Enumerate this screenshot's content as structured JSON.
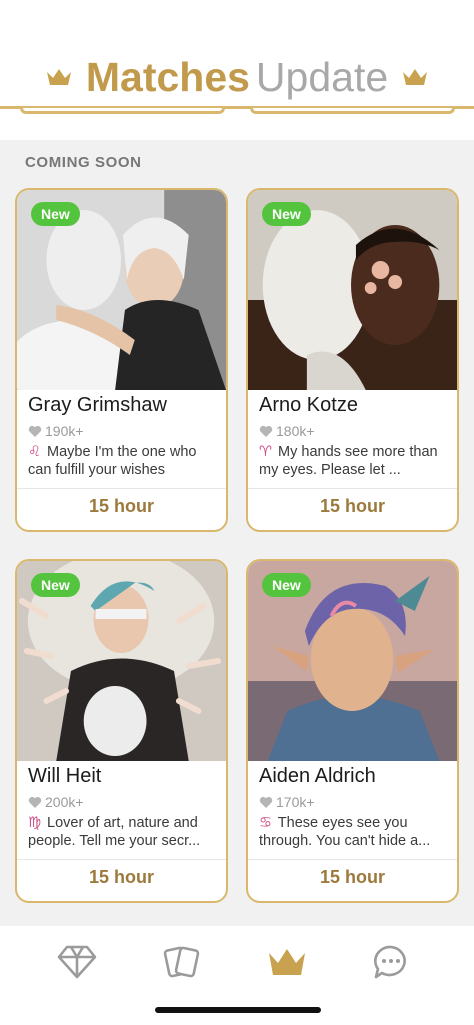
{
  "header": {
    "title_bold": "Matches",
    "title_light": "Update",
    "left_icon": "crown-icon",
    "right_icon": "crown-icon"
  },
  "section": {
    "label": "COMING SOON"
  },
  "cards": [
    {
      "badge": "New",
      "name": "Gray Grimshaw",
      "likes": "190k+",
      "zodiac": "♌",
      "bio": "Maybe I'm the one who can fulfill your wishes",
      "timer": "15 hour"
    },
    {
      "badge": "New",
      "name": "Arno Kotze",
      "likes": "180k+",
      "zodiac": "♈",
      "bio": "My hands see more than my eyes. Please let ...",
      "timer": "15 hour"
    },
    {
      "badge": "New",
      "name": "Will Heit",
      "likes": "200k+",
      "zodiac": "♍",
      "bio": "Lover of art, nature and people. Tell me your secr...",
      "timer": "15 hour"
    },
    {
      "badge": "New",
      "name": "Aiden Aldrich",
      "likes": "170k+",
      "zodiac": "♋",
      "bio": "These eyes see you through. You can't hide a...",
      "timer": "15 hour"
    }
  ],
  "nav": [
    {
      "icon": "diamond-icon"
    },
    {
      "icon": "cards-icon"
    },
    {
      "icon": "crown-icon",
      "active": true
    },
    {
      "icon": "chat-icon"
    }
  ],
  "colors": {
    "gold": "#c19a4c",
    "badge_green": "#54c43e",
    "zodiac_pink": "#d04f86"
  }
}
